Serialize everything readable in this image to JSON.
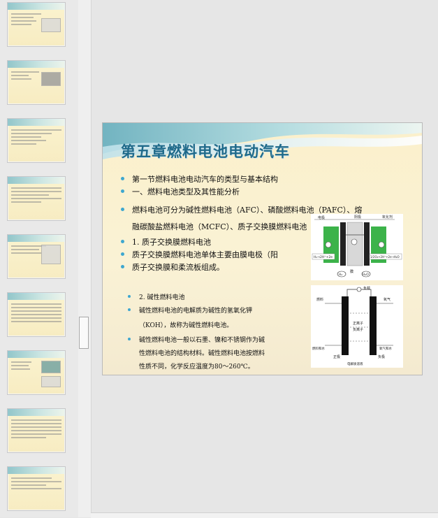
{
  "slide": {
    "title": "第五章燃料电池电动汽车",
    "bullets": [
      "第一节燃料电池电动汽车的类型与基本结构",
      "一、燃料电池类型及其性能分析",
      "燃料电池可分为碱性燃料电池（AFC）、磷酸燃料电池（PAFC）、熔",
      "融碳酸盐燃料电池（MCFC）、质子交换膜燃料电池（PEMFC）。",
      "1. 质子交换膜燃料电池",
      "质子交换膜燃料电池单体主要由膜电极（阳",
      "    质子交换膜和柔流板组成。"
    ],
    "afc_bullets": [
      "2. 碱性燃料电池",
      "碱性燃料电池的电解质为碱性的氢氧化钾",
      "（KOH），故称为碱性燃料电池。",
      "碱性燃料电池一般以石墨、镍和不锈钢作为碱",
      "性燃料电池的结构材料。碱性燃料电池按燃料",
      "性质不同，化学反应温度为80～260℃。"
    ],
    "pemfc_labels": {
      "top_left": "电极",
      "top_mid": "阴极",
      "top_right": "氧化剂",
      "left_eq": "H₂→2H⁺+2e",
      "right_eq": "1/2O₂+2H⁺+2e→H₂O",
      "membrane": "膜",
      "water": "H₂O",
      "hydrogen": "H₂"
    },
    "afc_labels": {
      "load": "负载",
      "fuel": "燃料",
      "oxygen": "氧气",
      "positive_ion": "正离子",
      "negative_ion": "负离子",
      "fuel_gas_water": "燃料和水",
      "oxygen_water": "氧气和水",
      "anode": "正极",
      "cathode": "负极",
      "electrolyte": "电解质溶液"
    }
  },
  "thumbnails": [
    {
      "index": 1
    },
    {
      "index": 2
    },
    {
      "index": 3
    },
    {
      "index": 4
    },
    {
      "index": 5
    },
    {
      "index": 6
    },
    {
      "index": 7
    },
    {
      "index": 8
    },
    {
      "index": 9
    }
  ],
  "colors": {
    "title": "#1f6a8a",
    "bullet": "#3ea7cf",
    "slide_bg": "#fbf0cb",
    "pemfc_green": "#3cb34a"
  }
}
